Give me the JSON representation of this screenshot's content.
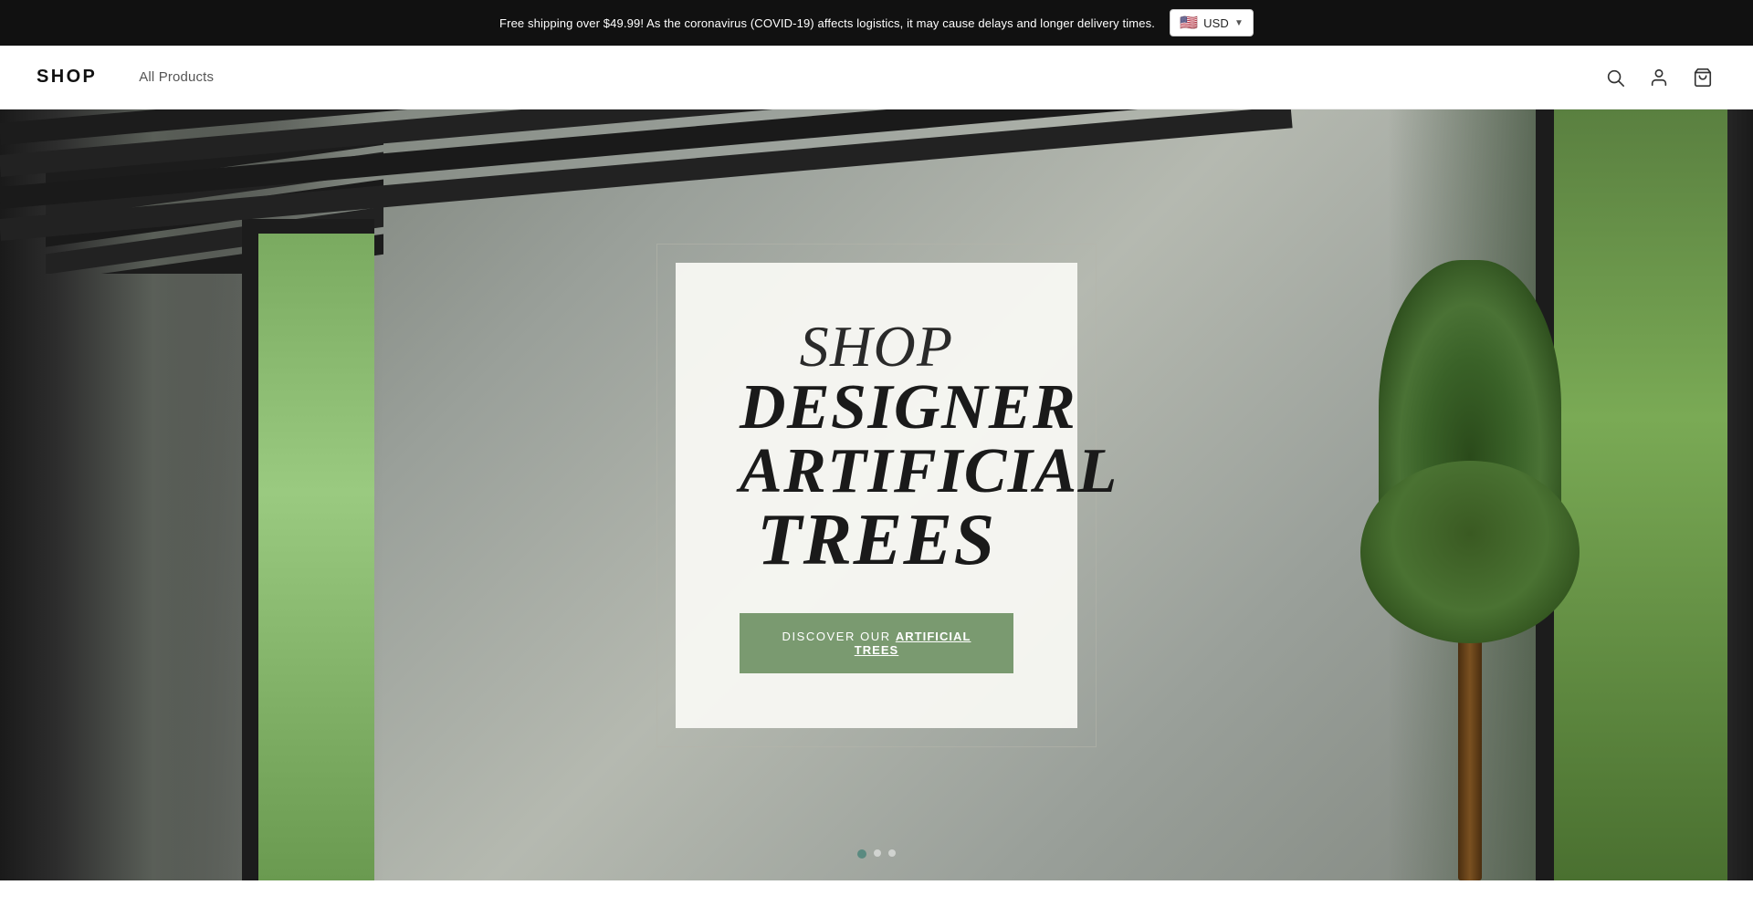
{
  "announcement": {
    "text": "Free shipping over $49.99! As the coronavirus (COVID-19) affects logistics, it may cause delays and longer delivery times.",
    "currency_label": "USD",
    "currency_flag": "🇺🇸"
  },
  "header": {
    "logo": "SHOP",
    "nav": [
      {
        "label": "All Products",
        "href": "#"
      }
    ],
    "icons": {
      "search": "search-icon",
      "account": "account-icon",
      "cart": "cart-icon"
    }
  },
  "hero": {
    "title_line1": "SHOP",
    "title_line2": "DESIGNER",
    "title_line3": "ARTIFICIAL",
    "title_line4": "TREES",
    "cta_prefix": "DISCOVER OUR ",
    "cta_underline": "ARTIFICIAL TREES",
    "cta_href": "#",
    "dots_count": 3,
    "active_dot": 0
  }
}
